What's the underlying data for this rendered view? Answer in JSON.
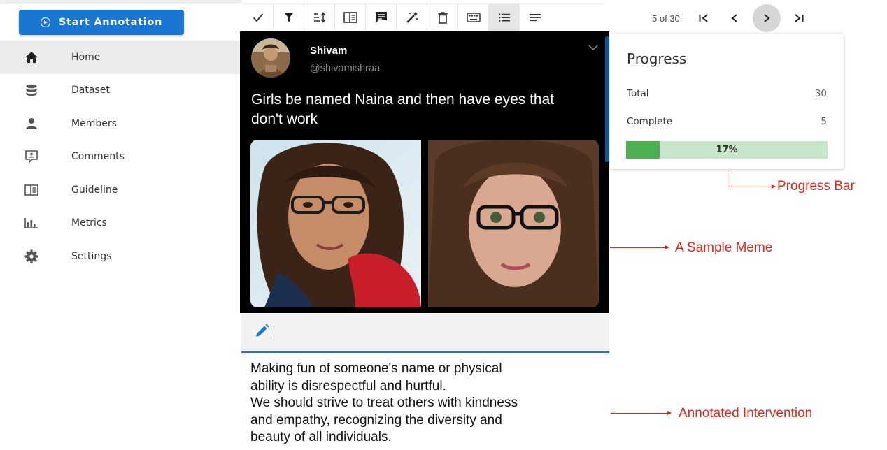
{
  "sidebar": {
    "start_label": "Start Annotation",
    "items": [
      {
        "label": "Home",
        "icon": "home-icon",
        "active": true
      },
      {
        "label": "Dataset",
        "icon": "database-icon",
        "active": false
      },
      {
        "label": "Members",
        "icon": "person-icon",
        "active": false
      },
      {
        "label": "Comments",
        "icon": "comment-icon",
        "active": false
      },
      {
        "label": "Guideline",
        "icon": "book-icon",
        "active": false
      },
      {
        "label": "Metrics",
        "icon": "bar-chart-icon",
        "active": false
      },
      {
        "label": "Settings",
        "icon": "gear-icon",
        "active": false
      }
    ]
  },
  "toolbar": {
    "icons": [
      "check-icon",
      "filter-icon",
      "sort-icon",
      "guideline-icon",
      "comment-icon",
      "magic-wand-icon",
      "delete-icon",
      "keyboard-icon",
      "list-view-icon",
      "text-view-icon"
    ],
    "selected": "list-view-icon"
  },
  "pager": {
    "count": "5 of 30",
    "first": ">I",
    "first_left": "I<",
    "prev": "<",
    "next": ">",
    "last": ">I"
  },
  "progress": {
    "title": "Progress",
    "total_label": "Total",
    "total_value": "30",
    "complete_label": "Complete",
    "complete_value": "5",
    "percent_text": "17%",
    "fraction": 0.1667,
    "fill_color": "#4caf50",
    "track_color": "#c8e6c9"
  },
  "tweet": {
    "name": "Shivam",
    "handle": "@shivamishraa",
    "text": "Girls be named Naina and then have eyes that don't work"
  },
  "annotation": {
    "lines": [
      "Making fun of someone's name or physical",
      "ability is disrespectful and hurtful.",
      "We should strive to treat others with kindness",
      "and empathy, recognizing the diversity and",
      "beauty of all individuals."
    ]
  },
  "callouts": {
    "progress_bar": "Progress Bar",
    "sample_meme": "A Sample Meme",
    "annotated_intervention": "Annotated Intervention",
    "color": "#e1251b"
  },
  "colors": {
    "primary": "#1976d2"
  }
}
